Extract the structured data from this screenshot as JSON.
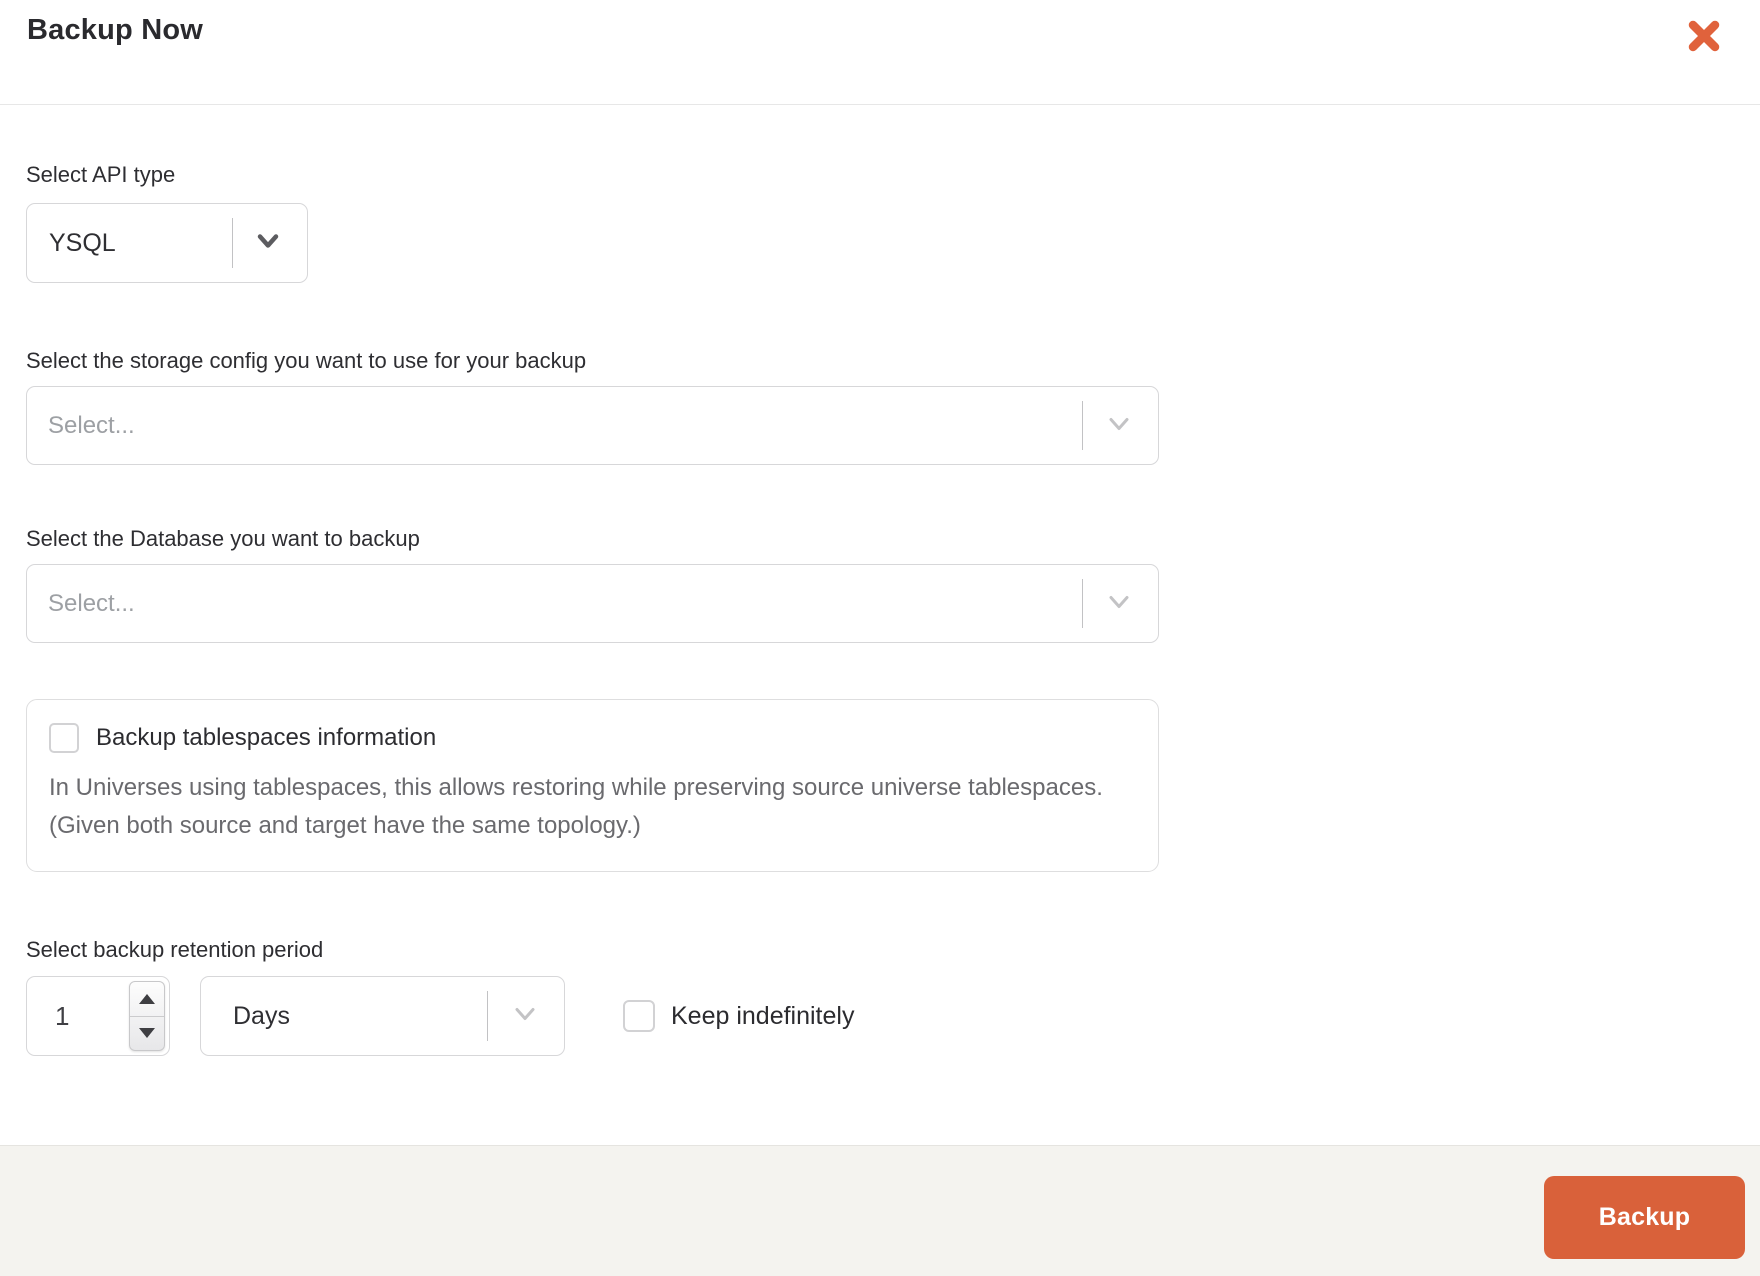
{
  "modal": {
    "title": "Backup Now"
  },
  "api_type": {
    "label": "Select API type",
    "value": "YSQL"
  },
  "storage_config": {
    "label": "Select the storage config you want to use for your backup",
    "placeholder": "Select..."
  },
  "database": {
    "label": "Select the Database you want to backup",
    "placeholder": "Select..."
  },
  "tablespaces": {
    "checkbox_label": "Backup tablespaces information",
    "checked": false,
    "description": "In Universes using tablespaces, this allows restoring while preserving source universe tablespaces. (Given both source and target have the same topology.)"
  },
  "retention": {
    "label": "Select backup retention period",
    "value": "1",
    "unit": "Days",
    "keep_indefinitely_label": "Keep indefinitely",
    "keep_indefinitely_checked": false
  },
  "footer": {
    "backup_button_label": "Backup"
  },
  "colors": {
    "accent_orange": "#d9613a",
    "footer_background": "#f4f3ef"
  },
  "icons": {
    "close": "close-icon",
    "chevron": "chevron-down-icon",
    "spin_up": "spinner-up-icon",
    "spin_down": "spinner-down-icon"
  }
}
